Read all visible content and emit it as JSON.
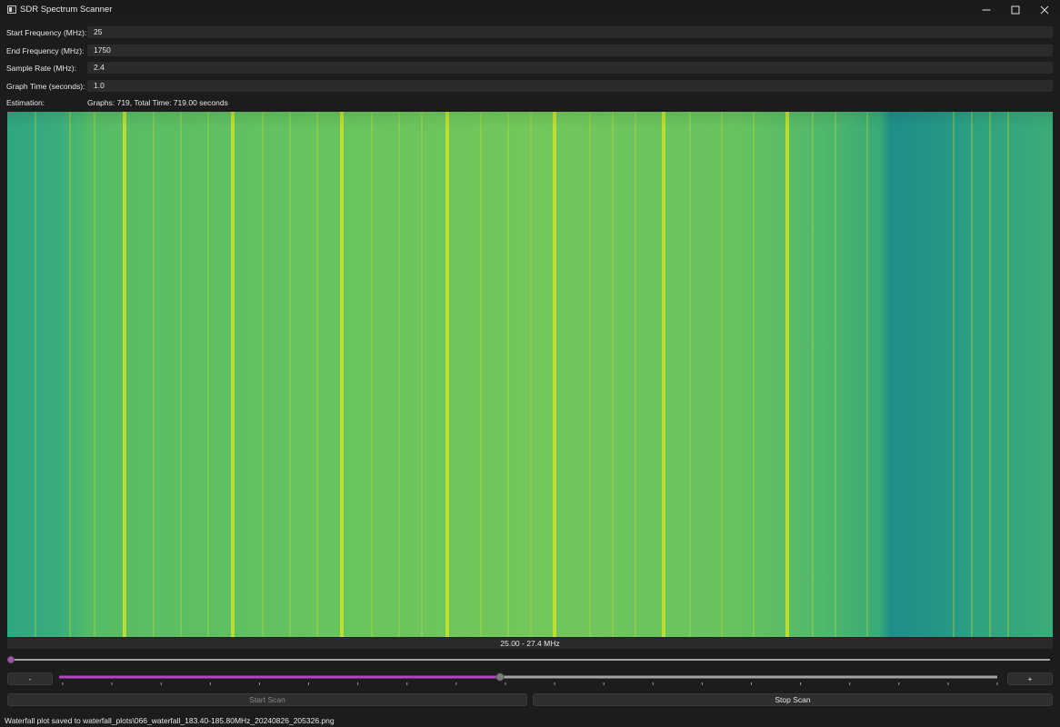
{
  "window": {
    "title": "SDR Spectrum Scanner",
    "minimize_icon": "minimize-icon",
    "maximize_icon": "maximize-icon",
    "close_icon": "close-icon"
  },
  "form": {
    "start_frequency": {
      "label": "Start Frequency (MHz):",
      "value": "25"
    },
    "end_frequency": {
      "label": "End Frequency (MHz):",
      "value": "1750"
    },
    "sample_rate": {
      "label": "Sample Rate (MHz):",
      "value": "2.4"
    },
    "graph_time": {
      "label": "Graph Time (seconds):",
      "value": "1.0"
    },
    "estimation": {
      "label": "Estimation:",
      "value": "Graphs: 719, Total Time: 719.00 seconds"
    }
  },
  "waterfall": {
    "range_label": "25.00 - 27.4 MHz",
    "colormap": [
      "#2a9d84",
      "#5cc05f",
      "#c7e020"
    ]
  },
  "controls": {
    "position_slider_value": 0,
    "zoom_minus_label": "-",
    "zoom_plus_label": "+",
    "zoom_slider_fraction": 0.47,
    "zoom_tick_count": 20,
    "accent_color": "#b545c5",
    "start_scan_label": "Start Scan",
    "start_scan_enabled": false,
    "stop_scan_label": "Stop Scan"
  },
  "status": {
    "message": "Waterfall plot saved to waterfall_plots\\066_waterfall_183.40-185.80MHz_20240826_205326.png"
  }
}
